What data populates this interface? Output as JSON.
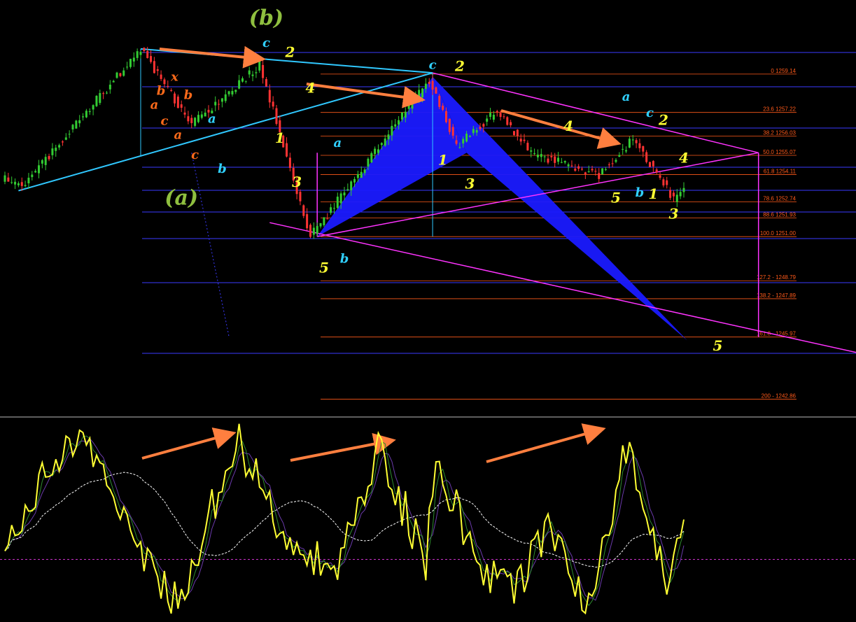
{
  "chart_data": {
    "type": "line",
    "title": "",
    "xlabel": "",
    "ylabel": "",
    "price_panel": {
      "ylim": [
        1242.0,
        1262.5
      ],
      "candles_count": 240,
      "fib_levels": [
        {
          "label": "0 1259.14",
          "price": 1259.14
        },
        {
          "label": "23.6 1257.22",
          "price": 1257.22
        },
        {
          "label": "38.2 1256.03",
          "price": 1256.03
        },
        {
          "label": "50.0 1255.07",
          "price": 1255.07
        },
        {
          "label": "61.8 1254.11",
          "price": 1254.11
        },
        {
          "label": "78.6 1252.74",
          "price": 1252.74
        },
        {
          "label": "88.6 1251.93",
          "price": 1251.93
        },
        {
          "label": "100.0 1251.00",
          "price": 1251.0
        },
        {
          "label": "127.2 - 1248.79",
          "price": 1248.79
        },
        {
          "label": "138.2 - 1247.89",
          "price": 1247.89
        },
        {
          "label": "161.8 - 1245.97",
          "price": 1245.97
        },
        {
          "label": "200 - 1242.86",
          "price": 1242.86
        }
      ],
      "swing_points": [
        {
          "bar": 0,
          "price": 1253.9
        },
        {
          "bar": 5,
          "price": 1253.5
        },
        {
          "bar": 40,
          "price": 1260.4
        },
        {
          "bar": 55,
          "price": 1256.6
        },
        {
          "bar": 75,
          "price": 1259.6
        },
        {
          "bar": 90,
          "price": 1251.0
        },
        {
          "bar": 125,
          "price": 1258.8
        },
        {
          "bar": 133,
          "price": 1255.5
        },
        {
          "bar": 145,
          "price": 1257.3
        },
        {
          "bar": 155,
          "price": 1255.2
        },
        {
          "bar": 175,
          "price": 1254.1
        },
        {
          "bar": 185,
          "price": 1255.9
        },
        {
          "bar": 197,
          "price": 1252.9
        },
        {
          "bar": 200,
          "price": 1253.3
        }
      ]
    },
    "oscillator_panel": {
      "ylim": [
        0,
        100
      ],
      "reference_level": 30,
      "points_count": 245,
      "swing_points": [
        {
          "bar": 0,
          "value": 35
        },
        {
          "bar": 10,
          "value": 70
        },
        {
          "bar": 24,
          "value": 95
        },
        {
          "bar": 35,
          "value": 50
        },
        {
          "bar": 52,
          "value": 5
        },
        {
          "bar": 68,
          "value": 93
        },
        {
          "bar": 82,
          "value": 40
        },
        {
          "bar": 98,
          "value": 25
        },
        {
          "bar": 110,
          "value": 85
        },
        {
          "bar": 124,
          "value": 30
        },
        {
          "bar": 127,
          "value": 77
        },
        {
          "bar": 140,
          "value": 30
        },
        {
          "bar": 150,
          "value": 10
        },
        {
          "bar": 160,
          "value": 50
        },
        {
          "bar": 172,
          "value": 5
        },
        {
          "bar": 183,
          "value": 85
        },
        {
          "bar": 195,
          "value": 18
        },
        {
          "bar": 200,
          "value": 55
        }
      ]
    },
    "wave_labels": [
      {
        "text": "(b)",
        "color": "#8fbf3f",
        "bar": 77,
        "price": 1261.6
      },
      {
        "text": "(a)",
        "color": "#8fbf3f",
        "bar": 52,
        "price": 1252.6
      },
      {
        "text": "c",
        "color": "#30d0ff",
        "bar": 77,
        "price": 1260.5
      },
      {
        "text": "b",
        "color": "#ff6a1a",
        "bar": 46,
        "price": 1258.1
      },
      {
        "text": "x",
        "color": "#ff6a1a",
        "bar": 50,
        "price": 1258.8
      },
      {
        "text": "b",
        "color": "#ff6a1a",
        "bar": 54,
        "price": 1257.9
      },
      {
        "text": "a",
        "color": "#ff6a1a",
        "bar": 44,
        "price": 1257.4
      },
      {
        "text": "c",
        "color": "#ff6a1a",
        "bar": 47,
        "price": 1256.6
      },
      {
        "text": "a",
        "color": "#ff6a1a",
        "bar": 51,
        "price": 1255.9
      },
      {
        "text": "a",
        "color": "#30d0ff",
        "bar": 61,
        "price": 1256.7
      },
      {
        "text": "c",
        "color": "#ff6a1a",
        "bar": 56,
        "price": 1254.9
      },
      {
        "text": "b",
        "color": "#30d0ff",
        "bar": 64,
        "price": 1254.2
      },
      {
        "text": "2",
        "color": "#ffff33",
        "bar": 84,
        "price": 1260.0
      },
      {
        "text": "4",
        "color": "#ffff33",
        "bar": 90,
        "price": 1258.2
      },
      {
        "text": "1",
        "color": "#ffff33",
        "bar": 81,
        "price": 1255.7
      },
      {
        "text": "3",
        "color": "#ffff33",
        "bar": 86,
        "price": 1253.5
      },
      {
        "text": "a",
        "color": "#30d0ff",
        "bar": 98,
        "price": 1255.5
      },
      {
        "text": "5",
        "color": "#ffff33",
        "bar": 94,
        "price": 1249.2
      },
      {
        "text": "b",
        "color": "#30d0ff",
        "bar": 100,
        "price": 1249.7
      },
      {
        "text": "c",
        "color": "#30d0ff",
        "bar": 126,
        "price": 1259.4
      },
      {
        "text": "2",
        "color": "#ffff33",
        "bar": 134,
        "price": 1259.3
      },
      {
        "text": "1",
        "color": "#ffff33",
        "bar": 129,
        "price": 1254.6
      },
      {
        "text": "3",
        "color": "#ffff33",
        "bar": 137,
        "price": 1253.4
      },
      {
        "text": "4",
        "color": "#ffff33",
        "bar": 166,
        "price": 1256.3
      },
      {
        "text": "a",
        "color": "#30d0ff",
        "bar": 183,
        "price": 1257.8
      },
      {
        "text": "c",
        "color": "#30d0ff",
        "bar": 190,
        "price": 1257.0
      },
      {
        "text": "2",
        "color": "#ffff33",
        "bar": 194,
        "price": 1256.6
      },
      {
        "text": "4",
        "color": "#ffff33",
        "bar": 200,
        "price": 1254.7
      },
      {
        "text": "5",
        "color": "#ffff33",
        "bar": 180,
        "price": 1252.7
      },
      {
        "text": "b",
        "color": "#30d0ff",
        "bar": 187,
        "price": 1253.0
      },
      {
        "text": "1",
        "color": "#ffff33",
        "bar": 191,
        "price": 1252.9
      },
      {
        "text": "3",
        "color": "#ffff33",
        "bar": 197,
        "price": 1251.9
      },
      {
        "text": "5",
        "color": "#ffff33",
        "bar": 210,
        "price": 1245.3
      }
    ]
  },
  "colors": {
    "background": "#000000",
    "bull_candle": "#33cc33",
    "bear_candle": "#ff3333",
    "fib_line": "#ff5a1a",
    "horizontal_line": "#3a3aff",
    "channel": "#ff33ff",
    "harmonic_fill": "#1a1aff",
    "arrow": "#ff7f3f",
    "oscillator_main": "#ffff33",
    "oscillator_signal_1": "#2e8b2e",
    "oscillator_signal_2": "#6a3aaa",
    "oscillator_ma": "#ffffff",
    "reference_line": "#cc33cc"
  }
}
